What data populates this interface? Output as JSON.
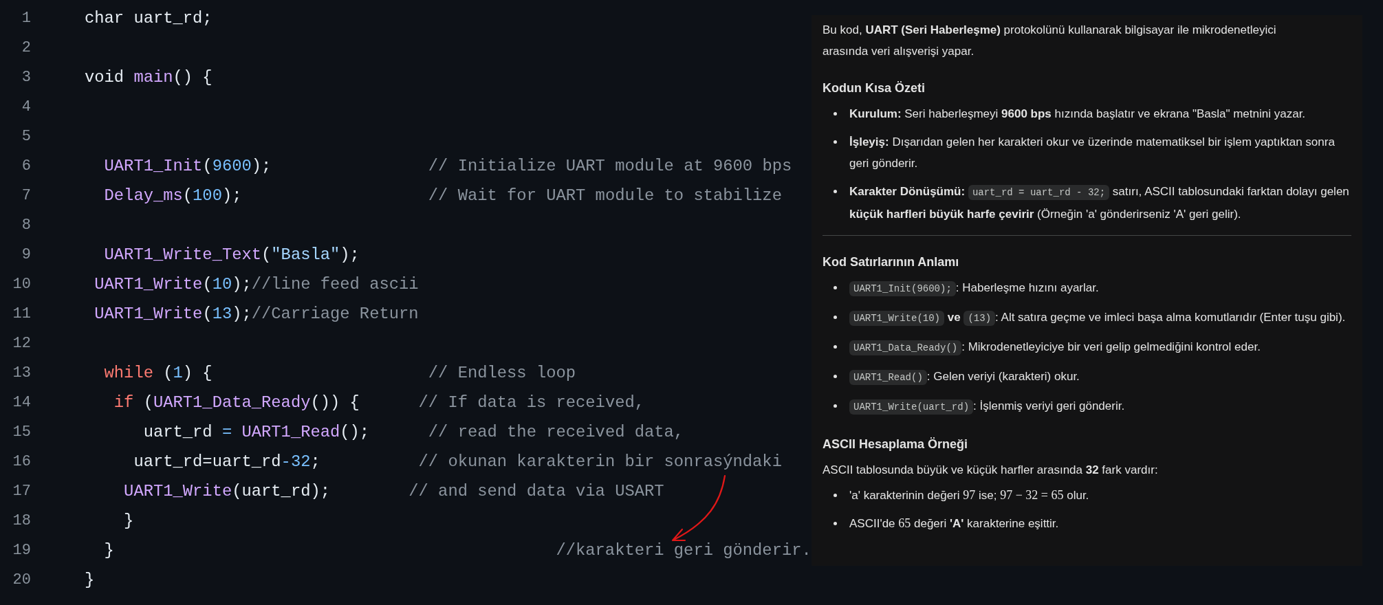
{
  "code": {
    "lines": [
      {
        "number": "1",
        "tokens": [
          {
            "kind": "plain",
            "text": "char uart_rd;"
          }
        ]
      },
      {
        "number": "2"
      },
      {
        "number": "3",
        "tokens": [
          {
            "kind": "plain",
            "text": "void "
          },
          {
            "kind": "func",
            "text": "main"
          },
          {
            "kind": "plain",
            "text": "() {"
          }
        ]
      },
      {
        "number": "4"
      },
      {
        "number": "5"
      },
      {
        "number": "6",
        "tokens": [
          {
            "kind": "func",
            "text": "  UART1_Init"
          },
          {
            "kind": "plain",
            "text": "("
          },
          {
            "kind": "number",
            "text": "9600"
          },
          {
            "kind": "plain",
            "text": ");                "
          },
          {
            "kind": "comment",
            "text": "// Initialize UART module at 9600 bps"
          }
        ]
      },
      {
        "number": "7",
        "tokens": [
          {
            "kind": "func",
            "text": "  Delay_ms"
          },
          {
            "kind": "plain",
            "text": "("
          },
          {
            "kind": "number",
            "text": "100"
          },
          {
            "kind": "plain",
            "text": ");                   "
          },
          {
            "kind": "comment",
            "text": "// Wait for UART module to stabilize"
          }
        ]
      },
      {
        "number": "8"
      },
      {
        "number": "9",
        "tokens": [
          {
            "kind": "func",
            "text": "  UART1_Write_Text"
          },
          {
            "kind": "plain",
            "text": "("
          },
          {
            "kind": "string",
            "text": "\"Basla\""
          },
          {
            "kind": "plain",
            "text": ");"
          }
        ]
      },
      {
        "number": "10",
        "tokens": [
          {
            "kind": "func",
            "text": " UART1_Write"
          },
          {
            "kind": "plain",
            "text": "("
          },
          {
            "kind": "number",
            "text": "10"
          },
          {
            "kind": "plain",
            "text": ");"
          },
          {
            "kind": "comment",
            "text": "//line feed ascii"
          }
        ]
      },
      {
        "number": "11",
        "tokens": [
          {
            "kind": "func",
            "text": " UART1_Write"
          },
          {
            "kind": "plain",
            "text": "("
          },
          {
            "kind": "number",
            "text": "13"
          },
          {
            "kind": "plain",
            "text": ");"
          },
          {
            "kind": "comment",
            "text": "//Carriage Return"
          }
        ]
      },
      {
        "number": "12"
      },
      {
        "number": "13",
        "tokens": [
          {
            "kind": "keyword",
            "text": "  while"
          },
          {
            "kind": "plain",
            "text": " ("
          },
          {
            "kind": "number",
            "text": "1"
          },
          {
            "kind": "plain",
            "text": ") {                      "
          },
          {
            "kind": "comment",
            "text": "// Endless loop"
          }
        ]
      },
      {
        "number": "14",
        "tokens": [
          {
            "kind": "keyword",
            "text": "   if"
          },
          {
            "kind": "plain",
            "text": " ("
          },
          {
            "kind": "func",
            "text": "UART1_Data_Ready"
          },
          {
            "kind": "plain",
            "text": "()) {      "
          },
          {
            "kind": "comment",
            "text": "// If data is received,"
          }
        ]
      },
      {
        "number": "15",
        "tokens": [
          {
            "kind": "plain",
            "text": "      uart_rd "
          },
          {
            "kind": "operator",
            "text": "="
          },
          {
            "kind": "func",
            "text": " UART1_Read"
          },
          {
            "kind": "plain",
            "text": "();      "
          },
          {
            "kind": "comment",
            "text": "// read the received data,"
          }
        ]
      },
      {
        "number": "16",
        "tokens": [
          {
            "kind": "plain",
            "text": "     uart_rd=uart_rd"
          },
          {
            "kind": "operator",
            "text": "-"
          },
          {
            "kind": "number",
            "text": "32"
          },
          {
            "kind": "plain",
            "text": ";          "
          },
          {
            "kind": "comment",
            "text": "// okunan karakterin bir sonrasýndaki"
          }
        ]
      },
      {
        "number": "17",
        "tokens": [
          {
            "kind": "func",
            "text": "    UART1_Write"
          },
          {
            "kind": "plain",
            "text": "(uart_rd);        "
          },
          {
            "kind": "comment",
            "text": "// and send data via USART"
          }
        ]
      },
      {
        "number": "18",
        "tokens": [
          {
            "kind": "plain",
            "text": "    }"
          }
        ]
      },
      {
        "number": "19",
        "tokens": [
          {
            "kind": "plain",
            "text": "  }                                             "
          },
          {
            "kind": "comment",
            "text": "//karakteri geri gönderir."
          }
        ]
      },
      {
        "number": "20",
        "tokens": [
          {
            "kind": "plain",
            "text": "}"
          }
        ]
      }
    ]
  },
  "explanation": {
    "intro": "Bu kod, **UART (Seri Haberleşme)** protokolünü kullanarak bilgisayar ile mikrodenetleyici arasında veri alışverişi yapar.",
    "sections": [
      {
        "heading": "Kodun Kısa Özeti",
        "divider_after": true,
        "bullets": [
          [
            {
              "kind": "text",
              "text": "**Kurulum:** Seri haberleşmeyi **9600 bps** hızında başlatır ve ekrana \"Basla\" metnini yazar."
            }
          ],
          [
            {
              "kind": "text",
              "text": "**İşleyiş:** Dışarıdan gelen her karakteri okur ve üzerinde matematiksel bir işlem yaptıktan sonra geri gönderir."
            }
          ],
          [
            {
              "kind": "text",
              "text": "**Karakter Dönüşümü:** "
            },
            {
              "kind": "code",
              "text": "uart_rd = uart_rd - 32;"
            },
            {
              "kind": "text",
              "text": " satırı, ASCII tablosundaki farktan dolayı gelen **küçük harfleri büyük harfe çevirir** (Örneğin 'a' gönderirseniz 'A' geri gelir)."
            }
          ]
        ]
      },
      {
        "heading": "Kod Satırlarının Anlamı",
        "divider_after": false,
        "bullets": [
          [
            {
              "kind": "code",
              "text": "UART1_Init(9600);"
            },
            {
              "kind": "text",
              "text": ": Haberleşme hızını ayarlar."
            }
          ],
          [
            {
              "kind": "code",
              "text": "UART1_Write(10)"
            },
            {
              "kind": "text",
              "text": " **ve** "
            },
            {
              "kind": "code",
              "text": "(13)"
            },
            {
              "kind": "text",
              "text": ": Alt satıra geçme ve imleci başa alma komutlarıdır (Enter tuşu gibi)."
            }
          ],
          [
            {
              "kind": "code",
              "text": "UART1_Data_Ready()"
            },
            {
              "kind": "text",
              "text": ": Mikrodenetleyiciye bir veri gelip gelmediğini kontrol eder."
            }
          ],
          [
            {
              "kind": "code",
              "text": "UART1_Read()"
            },
            {
              "kind": "text",
              "text": ": Gelen veriyi (karakteri) okur."
            }
          ],
          [
            {
              "kind": "code",
              "text": "UART1_Write(uart_rd)"
            },
            {
              "kind": "text",
              "text": ": İşlenmiş veriyi geri gönderir."
            }
          ]
        ]
      },
      {
        "heading": "ASCII Hesaplama Örneği",
        "divider_after": false,
        "paragraph": "ASCII tablosunda büyük ve küçük harfler arasında **32** fark vardır:",
        "bullets": [
          [
            {
              "kind": "text",
              "text": "'a' karakterinin değeri "
            },
            {
              "kind": "math",
              "text": "97"
            },
            {
              "kind": "text",
              "text": " ise; "
            },
            {
              "kind": "math",
              "text": "97 − 32 = 65"
            },
            {
              "kind": "text",
              "text": " olur."
            }
          ],
          [
            {
              "kind": "text",
              "text": "ASCII'de "
            },
            {
              "kind": "math",
              "text": "65"
            },
            {
              "kind": "text",
              "text": " değeri **'A'** karakterine eşittir."
            }
          ]
        ]
      }
    ]
  }
}
